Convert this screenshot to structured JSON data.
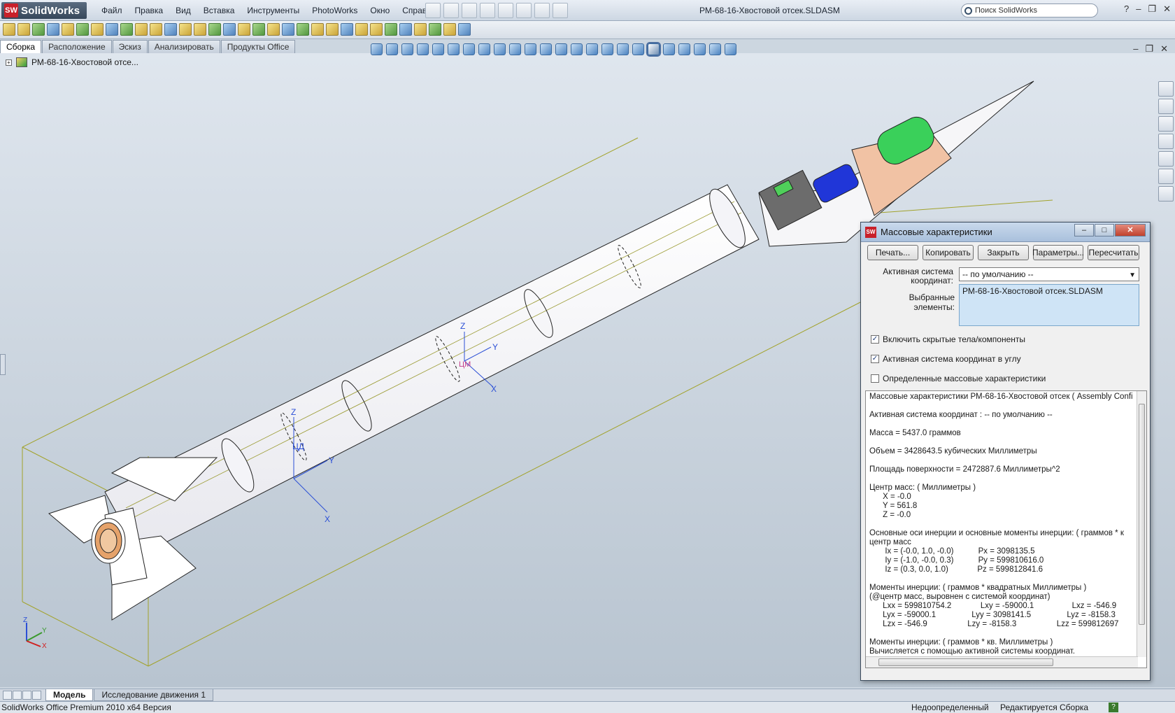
{
  "app": {
    "name": "SolidWorks",
    "logo_mark": "SW"
  },
  "menu": [
    "Файл",
    "Правка",
    "Вид",
    "Вставка",
    "Инструменты",
    "PhotoWorks",
    "Окно",
    "Справка"
  ],
  "window": {
    "title": "РМ-68-16-Хвостовой отсек.SLDASM",
    "search_placeholder": "Поиск SolidWorks"
  },
  "command_tabs": [
    "Сборка",
    "Расположение",
    "Эскиз",
    "Анализировать",
    "Продукты Office"
  ],
  "tree": {
    "root_label": "РМ-68-16-Хвостовой отсе..."
  },
  "viewport": {
    "markers": {
      "center_mark_1": "ЦД",
      "center_mark_2": "ЦМ",
      "axis_x": "X",
      "axis_y": "Y",
      "axis_z": "Z"
    }
  },
  "dialog": {
    "title": "Массовые характеристики",
    "buttons": {
      "print": "Печать...",
      "copy": "Копировать",
      "close": "Закрыть",
      "options": "Параметры...",
      "recalc": "Пересчитать"
    },
    "coord_label": "Активная система координат:",
    "coord_value": "-- по умолчанию --",
    "selected_label": "Выбранные элементы:",
    "selected_value": "РМ-68-16-Хвостовой отсек.SLDASM",
    "checkbox_hidden": {
      "label": "Включить скрытые тела/компоненты",
      "checked": true
    },
    "checkbox_corner": {
      "label": "Активная система координат в углу",
      "checked": true
    },
    "checkbox_override": {
      "label": "Определенные массовые характеристики",
      "checked": false
    },
    "results": [
      "Массовые характеристики РМ-68-16-Хвостовой отсек ( Assembly Confi",
      "",
      "Активная система координат : -- по умолчанию --",
      "",
      "Масса = 5437.0 граммов",
      "",
      "Объем = 3428643.5 кубических Миллиметры",
      "",
      "Площадь поверхности = 2472887.6 Миллиметры^2",
      "",
      "Центр масс: ( Миллиметры )",
      "      X = -0.0",
      "      Y = 561.8",
      "      Z = -0.0",
      "",
      "Основные оси инерции и основные моменты инерции: ( граммов * к",
      "центр масс",
      "       Ix = (-0.0, 1.0, -0.0)           Px = 3098135.5",
      "       Iy = (-1.0, -0.0, 0.3)           Py = 599810616.0",
      "       Iz = (0.3, 0.0, 1.0)             Pz = 599812841.6",
      "",
      "Моменты инерции: ( граммов * квадратных Миллиметры )",
      "(@центр масс, выровнен с системой координат)",
      "      Lxx = 599810754.2             Lxy = -59000.1                 Lxz = -546.9",
      "      Lyx = -59000.1                Lyy = 3098141.5                Lyz = -8158.3",
      "      Lzx = -546.9                  Lzy = -8158.3                  Lzz = 599812697",
      "",
      "Моменты инерции: ( граммов * кв. Миллиметры )",
      "Вычисляется с помощью активной системы координат."
    ]
  },
  "bottom_tabs": [
    "Модель",
    "Исследование движения 1"
  ],
  "status": {
    "left": "SolidWorks Office Premium 2010 x64 Версия",
    "state": "Недоопределенный",
    "editing": "Редактируется Сборка"
  },
  "colors": {
    "bg_top": "#dfe6ee",
    "bg_bottom": "#b8c4d0",
    "accent_green": "#3ad05a",
    "accent_blue": "#2036d8",
    "bbox_line": "#a2a22a",
    "nozzle": "#e5a26a"
  }
}
